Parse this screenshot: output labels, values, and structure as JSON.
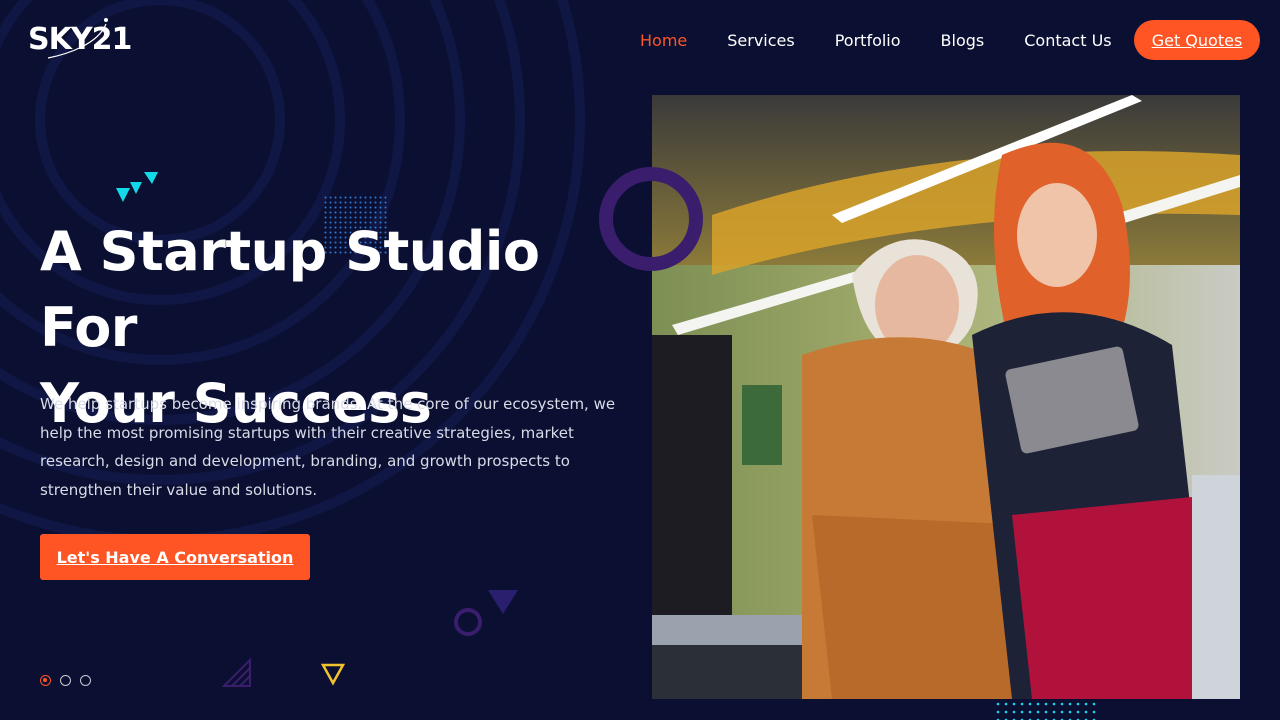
{
  "brand": {
    "logo_text": "SKY21"
  },
  "nav": {
    "items": [
      {
        "label": "Home",
        "active": true
      },
      {
        "label": "Services"
      },
      {
        "label": "Portfolio"
      },
      {
        "label": "Blogs"
      },
      {
        "label": "Contact Us"
      }
    ],
    "cta_label": "Get Quotes"
  },
  "hero": {
    "title_line1": "A Startup Studio For",
    "title_line2": "Your Success",
    "description": "We help startups become inspiring brands. At the core of our ecosystem, we help the most promising startups with their creative strategies, market research, design and development, branding, and growth prospects to strengthen their value and solutions.",
    "cta_label": "Let's Have A Conversation",
    "slides": {
      "count": 3,
      "active_index": 0
    }
  },
  "colors": {
    "background": "#0b1033",
    "accent": "#ff5525",
    "teal": "#12d9e8",
    "purple_ring": "#3b1d6e",
    "gold": "#f2c12e"
  },
  "icons": [
    "logo-swoosh-icon",
    "triangles-icon",
    "dot-grid-icon",
    "ring-icon",
    "triangle-outline-icon",
    "hatched-triangle-icon"
  ]
}
